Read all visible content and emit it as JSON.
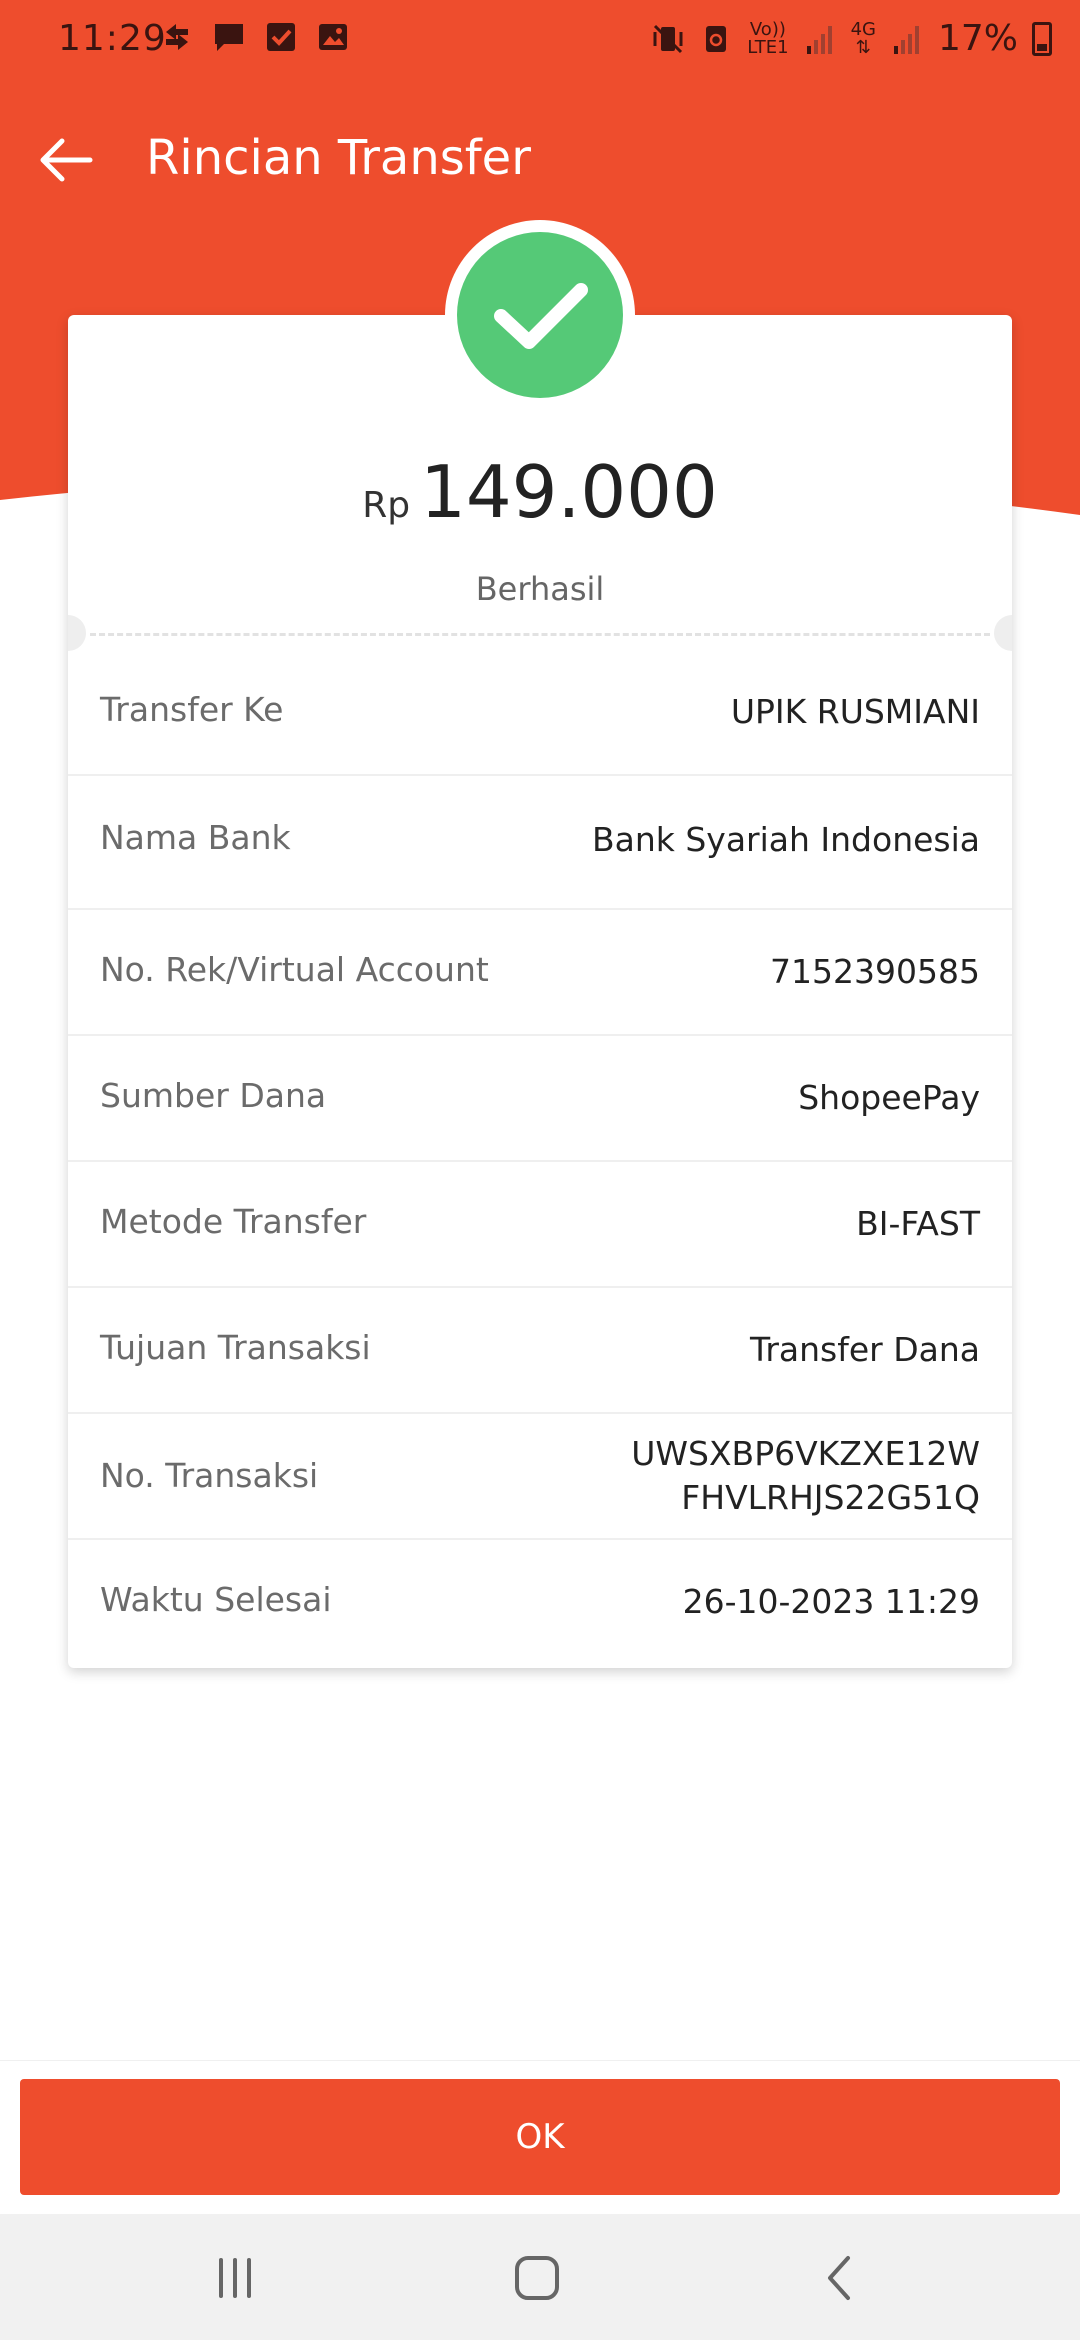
{
  "status_bar": {
    "time": "11:29",
    "network_top": "Vo))",
    "network_bottom": "LTE1",
    "net2_top": "4G",
    "battery_percent": "17%",
    "icons_left": [
      "transfer-icon",
      "message-icon",
      "checkbox-icon",
      "gallery-icon"
    ],
    "icons_right": [
      "mute-vibrate-icon",
      "recycle-icon",
      "signal-icon",
      "signal-icon",
      "battery-icon"
    ]
  },
  "header": {
    "title": "Rincian Transfer",
    "accent_color": "#ee4d2d"
  },
  "summary": {
    "currency": "Rp",
    "amount": "149.000",
    "status": "Berhasil",
    "status_color": "#55c977"
  },
  "details": [
    {
      "label": "Transfer Ke",
      "value": "UPIK RUSMIANI"
    },
    {
      "label": "Nama Bank",
      "value": "Bank Syariah Indonesia"
    },
    {
      "label": "No. Rek/Virtual Account",
      "value": "7152390585"
    },
    {
      "label": "Sumber Dana",
      "value": "ShopeePay"
    },
    {
      "label": "Metode Transfer",
      "value": "BI-FAST"
    },
    {
      "label": "Tujuan Transaksi",
      "value": "Transfer Dana"
    },
    {
      "label": "No. Transaksi",
      "value": "UWSXBP6VKZXE12W",
      "value2": "FHVLRHJS22G51Q"
    },
    {
      "label": "Waktu Selesai",
      "value": "26-10-2023 11:29"
    }
  ],
  "actions": {
    "ok_label": "OK"
  }
}
